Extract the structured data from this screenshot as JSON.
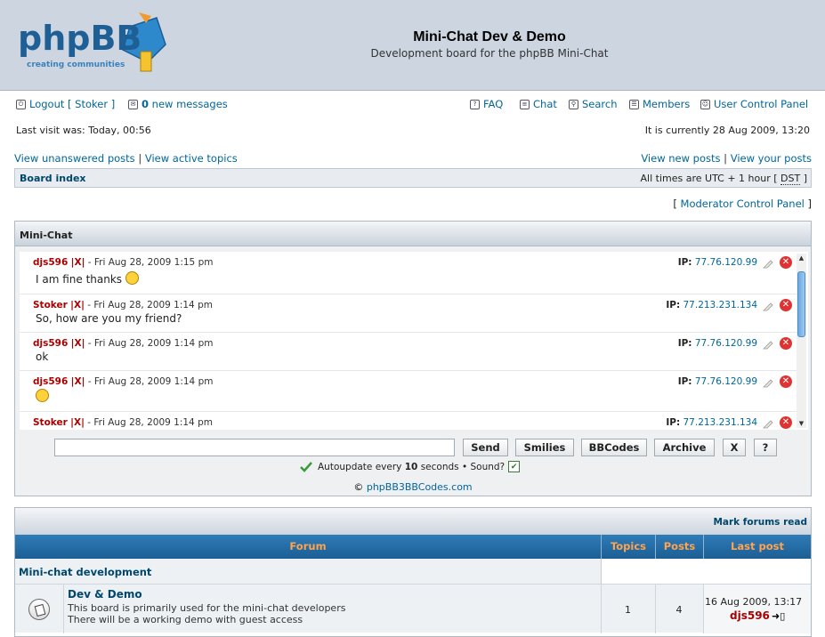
{
  "header": {
    "logo_text": "phpBB",
    "logo_tagline": "creating communities",
    "title": "Mini-Chat Dev & Demo",
    "description": "Development board for the phpBB Mini-Chat"
  },
  "nav": {
    "logout": "Logout [ Stoker ]",
    "pm_count": "0",
    "pm_label": "new messages",
    "faq": "FAQ",
    "chat": "Chat",
    "search": "Search",
    "members": "Members",
    "ucp": "User Control Panel"
  },
  "info": {
    "last_visit": "Last visit was: Today, 00:56",
    "current_time": "It is currently 28 Aug 2009, 13:20"
  },
  "links": {
    "unanswered": "View unanswered posts",
    "active": "View active topics",
    "new_posts": "View new posts",
    "your_posts": "View your posts"
  },
  "breadcrumb": {
    "board_index": "Board index",
    "timezone_pre": "All times are UTC + 1 hour [",
    "timezone_dst": "DST",
    "timezone_post": "]"
  },
  "mcp": {
    "open": "[",
    "label": "Moderator Control Panel",
    "close": "]"
  },
  "chat": {
    "title": "Mini-Chat",
    "messages": [
      {
        "user": "djs596",
        "x": "|X|",
        "time": "- Fri Aug 28, 2009 1:15 pm",
        "text": "I am fine thanks",
        "smiley": true,
        "ip_label": "IP:",
        "ip": "77.76.120.99"
      },
      {
        "user": "Stoker",
        "x": "|X|",
        "time": "- Fri Aug 28, 2009 1:14 pm",
        "text": "So, how are you my friend?",
        "smiley": false,
        "ip_label": "IP:",
        "ip": "77.213.231.134"
      },
      {
        "user": "djs596",
        "x": "|X|",
        "time": "- Fri Aug 28, 2009 1:14 pm",
        "text": "ok",
        "smiley": false,
        "ip_label": "IP:",
        "ip": "77.76.120.99"
      },
      {
        "user": "djs596",
        "x": "|X|",
        "time": "- Fri Aug 28, 2009 1:14 pm",
        "text": "",
        "smiley": true,
        "ip_label": "IP:",
        "ip": "77.76.120.99"
      },
      {
        "user": "Stoker",
        "x": "|X|",
        "time": "- Fri Aug 28, 2009 1:14 pm",
        "text": "",
        "smiley": false,
        "ip_label": "IP:",
        "ip": "77.213.231.134"
      }
    ],
    "input_value": "",
    "buttons": {
      "send": "Send",
      "smilies": "Smilies",
      "bbcodes": "BBCodes",
      "archive": "Archive",
      "close": "X",
      "help": "?"
    },
    "autoupdate_pre": "Autoupdate every",
    "autoupdate_secs": "10",
    "autoupdate_post": "seconds • Sound?",
    "sound_checked": true,
    "copyright_symbol": "©",
    "copyright_link": "phpBB3BBCodes.com"
  },
  "forums": {
    "mark_read": "Mark forums read",
    "columns": [
      "Forum",
      "Topics",
      "Posts",
      "Last post"
    ],
    "category": "Mini-chat development",
    "rows": [
      {
        "name": "Dev & Demo",
        "desc1": "This board is primarily used for the mini-chat developers",
        "desc2": "There will be a working demo with guest access",
        "topics": "1",
        "posts": "4",
        "last_date": "16 Aug 2009, 13:17",
        "last_user": "djs596"
      }
    ]
  },
  "colors": {
    "header_bg": "#ccd5e0",
    "link": "#006699",
    "username": "#aa0000",
    "table_head": "#1b5e94",
    "table_head_text": "#ffa34f"
  }
}
